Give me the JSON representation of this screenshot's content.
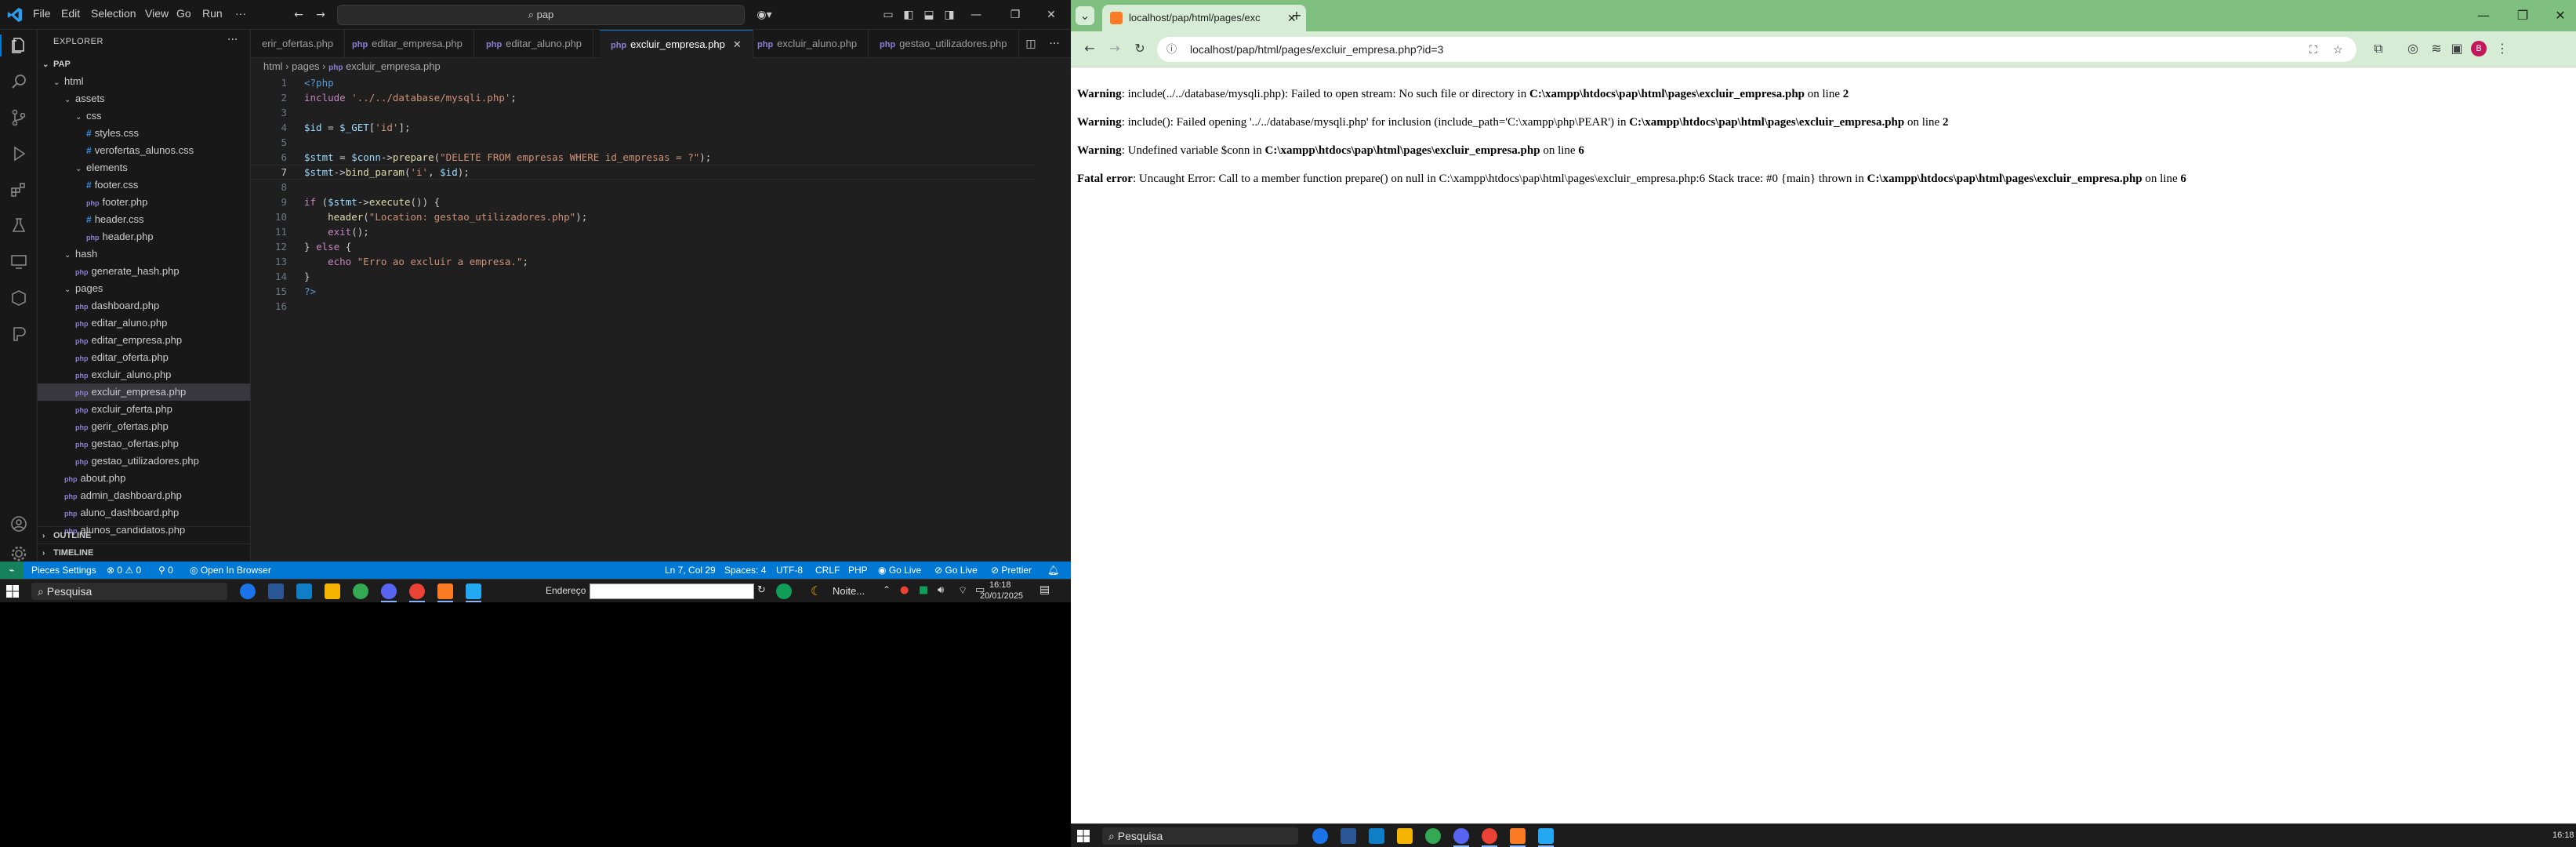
{
  "vscode": {
    "menu": [
      "File",
      "Edit",
      "Selection",
      "View",
      "Go",
      "Run",
      "···"
    ],
    "search_text": "pap",
    "explorer_title": "EXPLORER",
    "project": "PAP",
    "tree": [
      {
        "label": "html",
        "type": "folder",
        "indent": 1,
        "open": true
      },
      {
        "label": "assets",
        "type": "folder",
        "indent": 2,
        "open": true
      },
      {
        "label": "css",
        "type": "folder",
        "indent": 3,
        "open": true
      },
      {
        "label": "styles.css",
        "type": "css",
        "indent": 4
      },
      {
        "label": "verofertas_alunos.css",
        "type": "css",
        "indent": 4
      },
      {
        "label": "elements",
        "type": "folder",
        "indent": 3,
        "open": true
      },
      {
        "label": "footer.css",
        "type": "css",
        "indent": 4
      },
      {
        "label": "footer.php",
        "type": "php",
        "indent": 4
      },
      {
        "label": "header.css",
        "type": "css",
        "indent": 4
      },
      {
        "label": "header.php",
        "type": "php",
        "indent": 4
      },
      {
        "label": "hash",
        "type": "folder",
        "indent": 2,
        "open": true
      },
      {
        "label": "generate_hash.php",
        "type": "php",
        "indent": 3
      },
      {
        "label": "pages",
        "type": "folder",
        "indent": 2,
        "open": true
      },
      {
        "label": "dashboard.php",
        "type": "php",
        "indent": 3
      },
      {
        "label": "editar_aluno.php",
        "type": "php",
        "indent": 3
      },
      {
        "label": "editar_empresa.php",
        "type": "php",
        "indent": 3
      },
      {
        "label": "editar_oferta.php",
        "type": "php",
        "indent": 3
      },
      {
        "label": "excluir_aluno.php",
        "type": "php",
        "indent": 3
      },
      {
        "label": "excluir_empresa.php",
        "type": "php",
        "indent": 3,
        "selected": true
      },
      {
        "label": "excluir_oferta.php",
        "type": "php",
        "indent": 3
      },
      {
        "label": "gerir_ofertas.php",
        "type": "php",
        "indent": 3
      },
      {
        "label": "gestao_ofertas.php",
        "type": "php",
        "indent": 3
      },
      {
        "label": "gestao_utilizadores.php",
        "type": "php",
        "indent": 3
      },
      {
        "label": "about.php",
        "type": "php",
        "indent": 2
      },
      {
        "label": "admin_dashboard.php",
        "type": "php",
        "indent": 2
      },
      {
        "label": "aluno_dashboard.php",
        "type": "php",
        "indent": 2
      },
      {
        "label": "alunos_candidatos.php",
        "type": "php",
        "indent": 2
      }
    ],
    "outline_label": "OUTLINE",
    "timeline_label": "TIMELINE",
    "tabs": [
      "erir_ofertas.php",
      "editar_empresa.php",
      "editar_aluno.php",
      "excluir_empresa.php",
      "excluir_aluno.php",
      "gestao_utilizadores.php"
    ],
    "active_tab": "excluir_empresa.php",
    "breadcrumb": [
      "html",
      "pages",
      "excluir_empresa.php"
    ],
    "code_lines": [
      "<?php",
      "include '../../database/mysqli.php';",
      "",
      "$id = $_GET['id'];",
      "",
      "$stmt = $conn->prepare(\"DELETE FROM empresas WHERE id_empresas = ?\");",
      "$stmt->bind_param('i', $id);",
      "",
      "if ($stmt->execute()) {",
      "    header(\"Location: gestao_utilizadores.php\");",
      "    exit();",
      "} else {",
      "    echo \"Erro ao excluir a empresa.\";",
      "}",
      "?>",
      ""
    ],
    "status_left": {
      "pieces": "Pieces Settings",
      "errors": "0",
      "warnings": "0",
      "ports": "0",
      "browser": "Open In Browser"
    },
    "status_right": {
      "position": "Ln 7, Col 29",
      "spaces": "Spaces: 4",
      "encoding": "UTF-8",
      "eol": "CRLF",
      "lang": "PHP",
      "golive1": "Go Live",
      "golive2": "Go Live",
      "prettier": "Prettier"
    },
    "colors": {
      "status_bar": "#0078d4",
      "remote": "#16825d"
    }
  },
  "taskbar_left": {
    "search": "Pesquisa",
    "address_label": "Endereço",
    "weather": "Noite...",
    "time": "16:18",
    "date": "20/01/2025"
  },
  "chrome": {
    "tab_title": "localhost/pap/html/pages/exc",
    "url": "localhost/pap/html/pages/excluir_empresa.php?id=3",
    "profile_initial": "B",
    "messages": [
      {
        "prefix": "Warning",
        "text": ": include(../../database/mysqli.php): Failed to open stream: No such file or directory in ",
        "file": "C:\\xampp\\htdocs\\pap\\html\\pages\\excluir_empresa.php",
        "on": " on line ",
        "line": "2"
      },
      {
        "prefix": "Warning",
        "text": ": include(): Failed opening '../../database/mysqli.php' for inclusion (include_path='C:\\xampp\\php\\PEAR') in ",
        "file": "C:\\xampp\\htdocs\\pap\\html\\pages\\excluir_empresa.php",
        "on": " on line ",
        "line": "2"
      },
      {
        "prefix": "Warning",
        "text": ": Undefined variable $conn in ",
        "file": "C:\\xampp\\htdocs\\pap\\html\\pages\\excluir_empresa.php",
        "on": " on line ",
        "line": "6"
      },
      {
        "prefix": "Fatal error",
        "text": ": Uncaught Error: Call to a member function prepare() on null in C:\\xampp\\htdocs\\pap\\html\\pages\\excluir_empresa.php:6 Stack trace: #0 {main} thrown in ",
        "file": "C:\\xampp\\htdocs\\pap\\html\\pages\\excluir_empresa.php",
        "on": " on line ",
        "line": "6"
      }
    ]
  },
  "taskbar_right": {
    "search": "Pesquisa",
    "time": "16:18"
  }
}
